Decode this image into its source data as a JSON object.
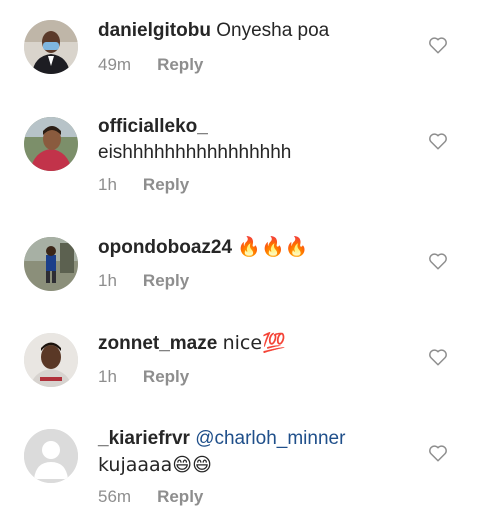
{
  "comments": [
    {
      "username": "danielgitobu",
      "text": "Onyesha poa",
      "time": "49m",
      "reply": "Reply",
      "avatar": "avatar-photo-masked-man-icon"
    },
    {
      "username": "officialleko_",
      "text": "eishhhhhhhhhhhhhhhh",
      "time": "1h",
      "reply": "Reply",
      "avatar": "avatar-photo-person-icon"
    },
    {
      "username": "opondoboaz24",
      "text": "🔥🔥🔥",
      "time": "1h",
      "reply": "Reply",
      "avatar": "avatar-photo-outdoor-icon"
    },
    {
      "username": "zonnet_maze",
      "text": "nice💯",
      "time": "1h",
      "reply": "Reply",
      "avatar": "avatar-photo-man-icon"
    },
    {
      "username": "_kiariefrvr",
      "mention": "@charloh_minner",
      "text": "kujaaaa😄😄",
      "time": "56m",
      "reply": "Reply",
      "avatar": "default-avatar-icon"
    }
  ]
}
